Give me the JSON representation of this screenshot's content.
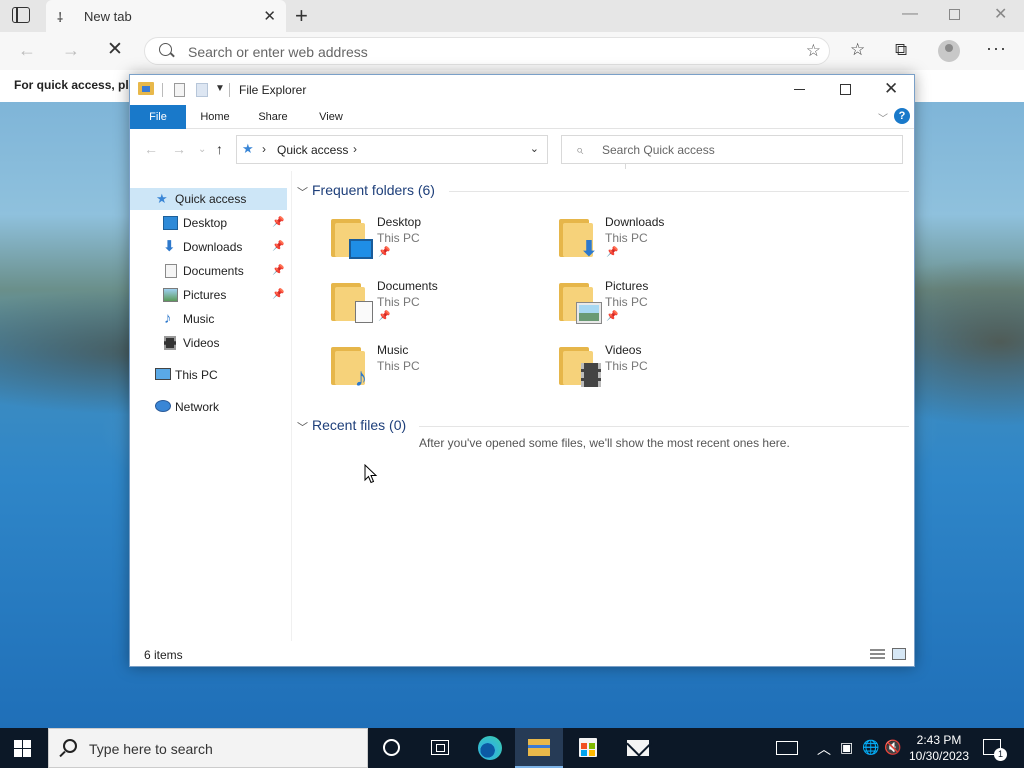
{
  "browser": {
    "tab_title": "New tab",
    "tab_favicon": "⸸",
    "address_placeholder": "Search or enter web address",
    "favorites_bar_text": "For quick access, plac"
  },
  "explorer": {
    "title": "File Explorer",
    "ribbon_tabs": [
      "File",
      "Home",
      "Share",
      "View"
    ],
    "address_path": "Quick access",
    "search_placeholder": "Search Quick access",
    "nav_pane": {
      "quick_access": "Quick access",
      "items": [
        {
          "label": "Desktop",
          "pinned": true,
          "icon": "desktop-icon"
        },
        {
          "label": "Downloads",
          "pinned": true,
          "icon": "downloads-icon"
        },
        {
          "label": "Documents",
          "pinned": true,
          "icon": "documents-icon"
        },
        {
          "label": "Pictures",
          "pinned": true,
          "icon": "pictures-icon"
        },
        {
          "label": "Music",
          "pinned": false,
          "icon": "music-icon"
        },
        {
          "label": "Videos",
          "pinned": false,
          "icon": "videos-icon"
        }
      ],
      "this_pc": "This PC",
      "network": "Network"
    },
    "frequent_header": "Frequent folders (6)",
    "folders": [
      {
        "name": "Desktop",
        "location": "This PC",
        "pinned": true
      },
      {
        "name": "Downloads",
        "location": "This PC",
        "pinned": true
      },
      {
        "name": "Documents",
        "location": "This PC",
        "pinned": true
      },
      {
        "name": "Pictures",
        "location": "This PC",
        "pinned": true
      },
      {
        "name": "Music",
        "location": "This PC",
        "pinned": false
      },
      {
        "name": "Videos",
        "location": "This PC",
        "pinned": false
      }
    ],
    "recent_header": "Recent files (0)",
    "recent_empty_message": "After you've opened some files, we'll show the most recent ones here.",
    "status_count": "6 items",
    "accent_color": "#1979ca"
  },
  "taskbar": {
    "search_placeholder": "Type here to search",
    "time": "2:43 PM",
    "date": "10/30/2023",
    "notification_count": "1"
  }
}
